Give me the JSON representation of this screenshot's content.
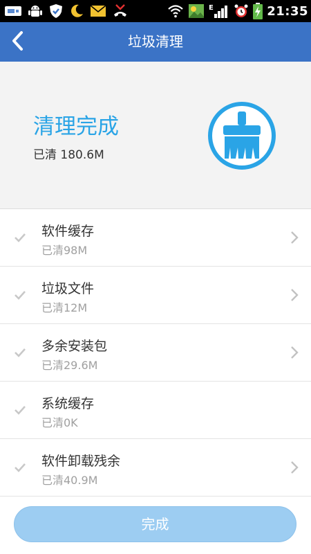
{
  "status_bar": {
    "time": "21:35",
    "network_label": "E",
    "icons": [
      "usb-icon",
      "android-debug-icon",
      "shield-icon",
      "moon-icon",
      "mail-icon",
      "missed-call-icon",
      "wifi-icon",
      "weather-icon",
      "signal-icon",
      "alarm-icon",
      "battery-charging-icon"
    ]
  },
  "header": {
    "title": "垃圾清理",
    "back_icon": "chevron-left-icon"
  },
  "summary": {
    "title": "清理完成",
    "cleaned": "已清 180.6M",
    "icon": "broom-icon",
    "accent_color": "#2aa4e6"
  },
  "items": [
    {
      "title": "软件缓存",
      "cleaned": "已清98M",
      "has_chevron": true
    },
    {
      "title": "垃圾文件",
      "cleaned": "已清12M",
      "has_chevron": true
    },
    {
      "title": "多余安装包",
      "cleaned": "已清29.6M",
      "has_chevron": true
    },
    {
      "title": "系统缓存",
      "cleaned": "已清0K",
      "has_chevron": false
    },
    {
      "title": "软件卸载残余",
      "cleaned": "已清40.9M",
      "has_chevron": true
    }
  ],
  "footer": {
    "done_label": "完成"
  },
  "colors": {
    "header_bg": "#3b73c6",
    "button_bg": "#9dcdf2"
  }
}
